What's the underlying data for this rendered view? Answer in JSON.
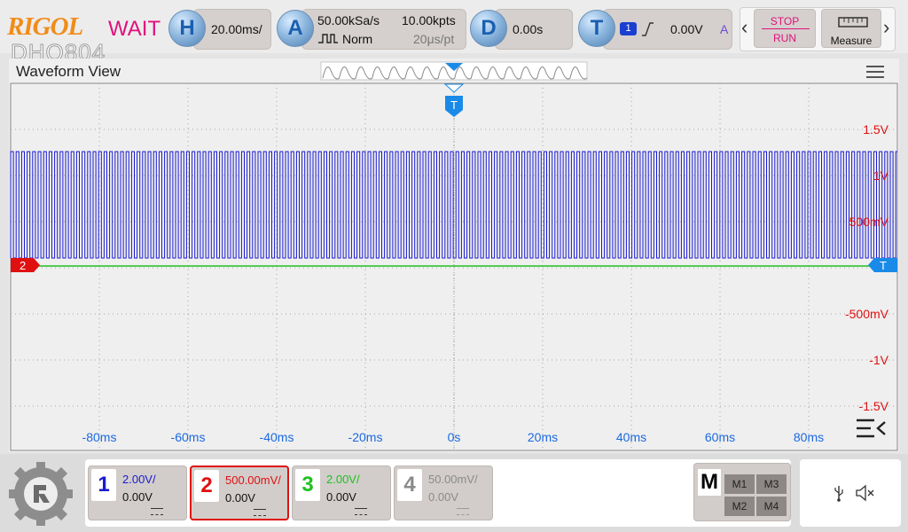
{
  "brand": {
    "logo": "RIGOL",
    "model": "DHO804"
  },
  "status": {
    "text": "WAIT",
    "color": "#e0107c"
  },
  "horizontal": {
    "letter": "H",
    "scale": "20.00ms/"
  },
  "acquire": {
    "letter": "A",
    "sample_rate": "50.00kSa/s",
    "mode": "Norm",
    "points": "10.00kpts",
    "time_per_pt": "20μs/pt"
  },
  "delay": {
    "letter": "D",
    "value": "0.00s"
  },
  "trigger": {
    "letter": "T",
    "source": "1",
    "level": "0.00V",
    "mode": "A"
  },
  "controls": {
    "stop_label": "STOP",
    "run_label": "RUN",
    "measure_label": "Measure"
  },
  "waveform_view": {
    "title": "Waveform View",
    "trigger_marker": "T",
    "channel_marker": "2",
    "right_trigger_marker": "T",
    "time_labels": [
      "-80ms",
      "-60ms",
      "-40ms",
      "-20ms",
      "0s",
      "20ms",
      "40ms",
      "60ms",
      "80ms"
    ],
    "volt_labels": [
      "1.5V",
      "1V",
      "500mV",
      "-500mV",
      "-1V",
      "-1.5V"
    ],
    "colors": {
      "ch1": "#1a1ad0",
      "ch2": "#e01010",
      "ch3": "#20c020",
      "ch4": "#8a8a8a",
      "trigger": "#1a8ae8",
      "volt_labels": "#e01010",
      "time_labels": "#1a6ae0"
    }
  },
  "channels": [
    {
      "num": "1",
      "scale": "2.00V/",
      "offset": "0.00V",
      "color": "#1a1ad0"
    },
    {
      "num": "2",
      "scale": "500.00mV/",
      "offset": "0.00V",
      "color": "#e01010"
    },
    {
      "num": "3",
      "scale": "2.00V/",
      "offset": "0.00V",
      "color": "#20c020"
    },
    {
      "num": "4",
      "scale": "50.00mV/",
      "offset": "0.00V",
      "color": "#8a8a8a"
    }
  ],
  "math": {
    "label": "M",
    "buttons": [
      "M1",
      "M3",
      "M2",
      "M4"
    ]
  }
}
